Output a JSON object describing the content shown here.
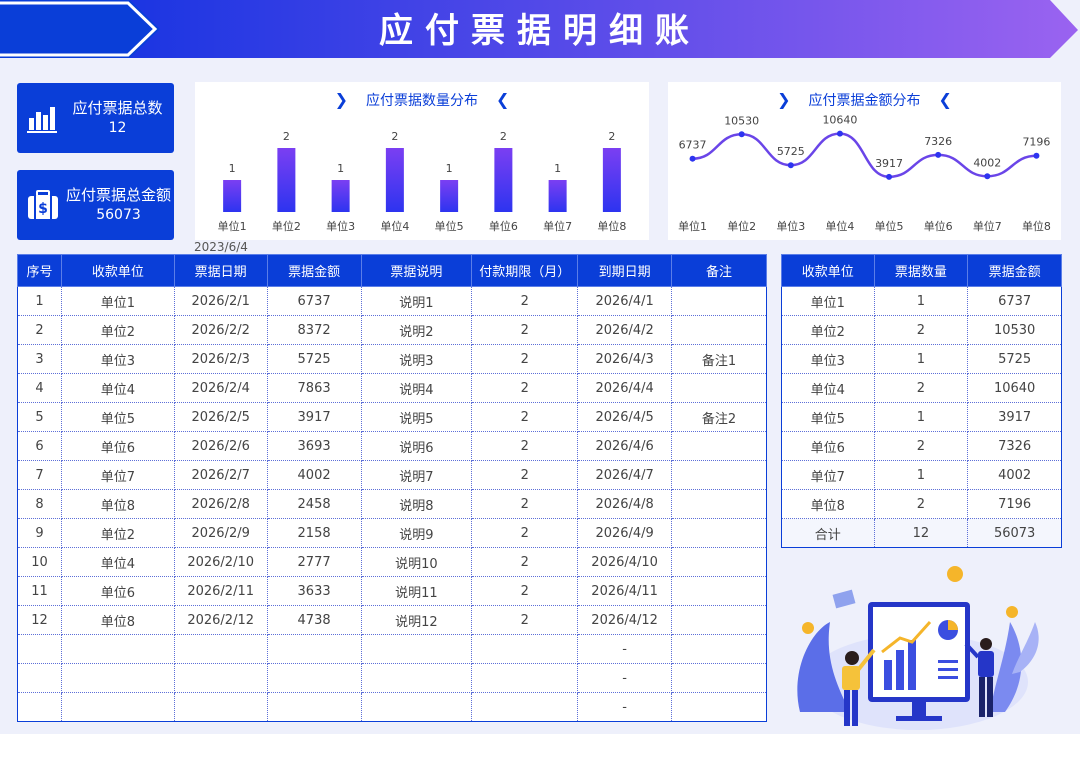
{
  "header": {
    "title": "应付票据明细账"
  },
  "kpis": [
    {
      "label": "应付票据总数",
      "value": "12",
      "icon": "bar-chart-icon"
    },
    {
      "label": "应付票据总金额",
      "value": "56073",
      "icon": "money-bag-icon"
    }
  ],
  "date": "2023/6/4",
  "colors": {
    "primary": "#0a3ed8",
    "bar_top": "#7b3ff2",
    "bar_bottom": "#2d34f0",
    "line": "#6a45e8"
  },
  "chart_count": {
    "title": "应付票据数量分布",
    "chart_data": {
      "type": "bar",
      "categories": [
        "单位1",
        "单位2",
        "单位3",
        "单位4",
        "单位5",
        "单位6",
        "单位7",
        "单位8"
      ],
      "values": [
        1,
        2,
        1,
        2,
        1,
        2,
        1,
        2
      ],
      "ylim": [
        0,
        2
      ]
    }
  },
  "chart_amount": {
    "title": "应付票据金额分布",
    "chart_data": {
      "type": "line",
      "categories": [
        "单位1",
        "单位2",
        "单位3",
        "单位4",
        "单位5",
        "单位6",
        "单位7",
        "单位8"
      ],
      "values": [
        6737,
        10530,
        5725,
        10640,
        3917,
        7326,
        4002,
        7196
      ],
      "ylim": [
        0,
        14000
      ]
    }
  },
  "detail_table": {
    "headers": [
      "序号",
      "收款单位",
      "票据日期",
      "票据金额",
      "票据说明",
      "付款期限（月）",
      "到期日期",
      "备注"
    ],
    "rows": [
      [
        "1",
        "单位1",
        "2026/2/1",
        "6737",
        "说明1",
        "2",
        "2026/4/1",
        ""
      ],
      [
        "2",
        "单位2",
        "2026/2/2",
        "8372",
        "说明2",
        "2",
        "2026/4/2",
        ""
      ],
      [
        "3",
        "单位3",
        "2026/2/3",
        "5725",
        "说明3",
        "2",
        "2026/4/3",
        "备注1"
      ],
      [
        "4",
        "单位4",
        "2026/2/4",
        "7863",
        "说明4",
        "2",
        "2026/4/4",
        ""
      ],
      [
        "5",
        "单位5",
        "2026/2/5",
        "3917",
        "说明5",
        "2",
        "2026/4/5",
        "备注2"
      ],
      [
        "6",
        "单位6",
        "2026/2/6",
        "3693",
        "说明6",
        "2",
        "2026/4/6",
        ""
      ],
      [
        "7",
        "单位7",
        "2026/2/7",
        "4002",
        "说明7",
        "2",
        "2026/4/7",
        ""
      ],
      [
        "8",
        "单位8",
        "2026/2/8",
        "2458",
        "说明8",
        "2",
        "2026/4/8",
        ""
      ],
      [
        "9",
        "单位2",
        "2026/2/9",
        "2158",
        "说明9",
        "2",
        "2026/4/9",
        ""
      ],
      [
        "10",
        "单位4",
        "2026/2/10",
        "2777",
        "说明10",
        "2",
        "2026/4/10",
        ""
      ],
      [
        "11",
        "单位6",
        "2026/2/11",
        "3633",
        "说明11",
        "2",
        "2026/4/11",
        ""
      ],
      [
        "12",
        "单位8",
        "2026/2/12",
        "4738",
        "说明12",
        "2",
        "2026/4/12",
        ""
      ],
      [
        "",
        "",
        "",
        "",
        "",
        "",
        "-",
        ""
      ],
      [
        "",
        "",
        "",
        "",
        "",
        "",
        "-",
        ""
      ],
      [
        "",
        "",
        "",
        "",
        "",
        "",
        "-",
        ""
      ]
    ]
  },
  "summary_table": {
    "headers": [
      "收款单位",
      "票据数量",
      "票据金额"
    ],
    "rows": [
      [
        "单位1",
        "1",
        "6737"
      ],
      [
        "单位2",
        "2",
        "10530"
      ],
      [
        "单位3",
        "1",
        "5725"
      ],
      [
        "单位4",
        "2",
        "10640"
      ],
      [
        "单位5",
        "1",
        "3917"
      ],
      [
        "单位6",
        "2",
        "7326"
      ],
      [
        "单位7",
        "1",
        "4002"
      ],
      [
        "单位8",
        "2",
        "7196"
      ]
    ],
    "total": [
      "合计",
      "12",
      "56073"
    ]
  }
}
